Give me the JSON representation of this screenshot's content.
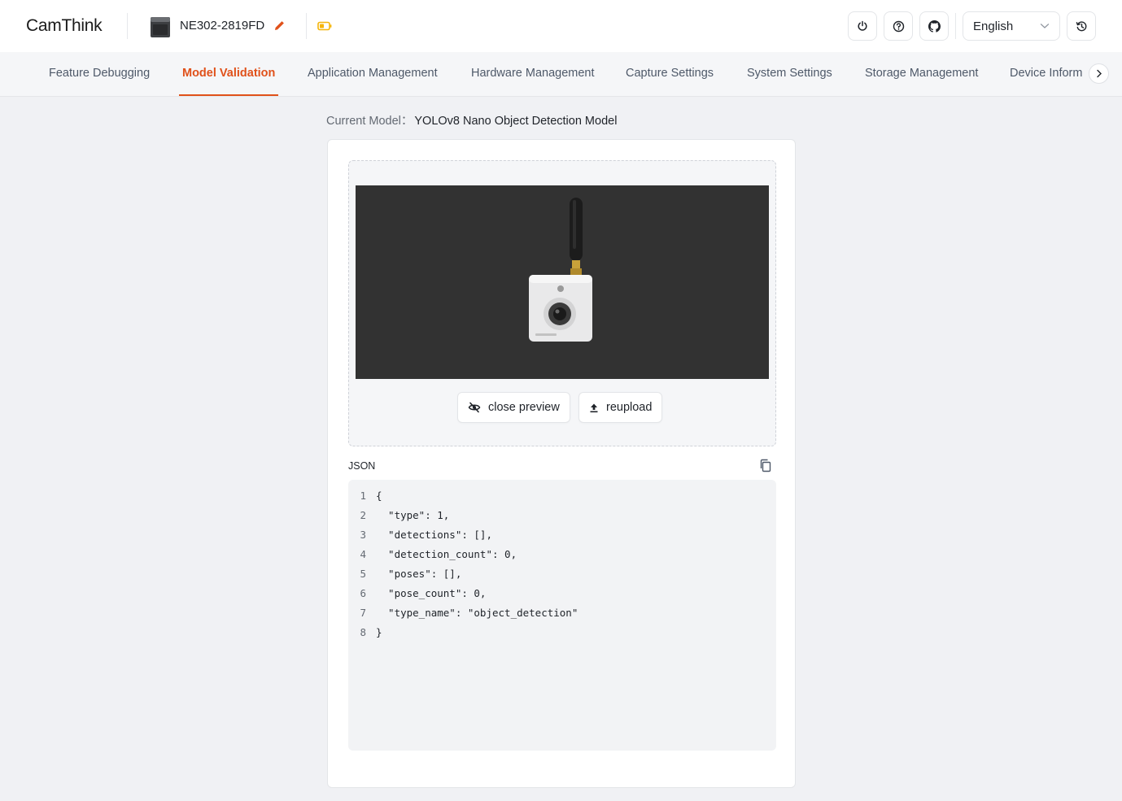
{
  "header": {
    "logo": "CamThink",
    "device_name": "NE302-2819FD",
    "language": "English",
    "icons": [
      "power-icon",
      "help-icon",
      "github-icon",
      "history-icon"
    ]
  },
  "tabs": [
    {
      "label": "Feature Debugging",
      "active": false
    },
    {
      "label": "Model Validation",
      "active": true
    },
    {
      "label": "Application Management",
      "active": false
    },
    {
      "label": "Hardware Management",
      "active": false
    },
    {
      "label": "Capture Settings",
      "active": false
    },
    {
      "label": "System Settings",
      "active": false
    },
    {
      "label": "Storage Management",
      "active": false
    },
    {
      "label": "Device Inform",
      "active": false
    }
  ],
  "main": {
    "current_model_label": "Current Model：",
    "current_model_value": "YOLOv8 Nano Object Detection Model",
    "close_preview_label": "close preview",
    "reupload_label": "reupload",
    "json_label": "JSON",
    "json_lines": [
      {
        "n": "1",
        "text": "{"
      },
      {
        "n": "2",
        "text": "  \"type\": 1,"
      },
      {
        "n": "3",
        "text": "  \"detections\": [],"
      },
      {
        "n": "4",
        "text": "  \"detection_count\": 0,"
      },
      {
        "n": "5",
        "text": "  \"poses\": [],"
      },
      {
        "n": "6",
        "text": "  \"pose_count\": 0,"
      },
      {
        "n": "7",
        "text": "  \"type_name\": \"object_detection\""
      },
      {
        "n": "8",
        "text": "}"
      }
    ]
  },
  "colors": {
    "accent": "#e0511a",
    "battery": "#f5b50a",
    "preview_bg": "#323232"
  }
}
